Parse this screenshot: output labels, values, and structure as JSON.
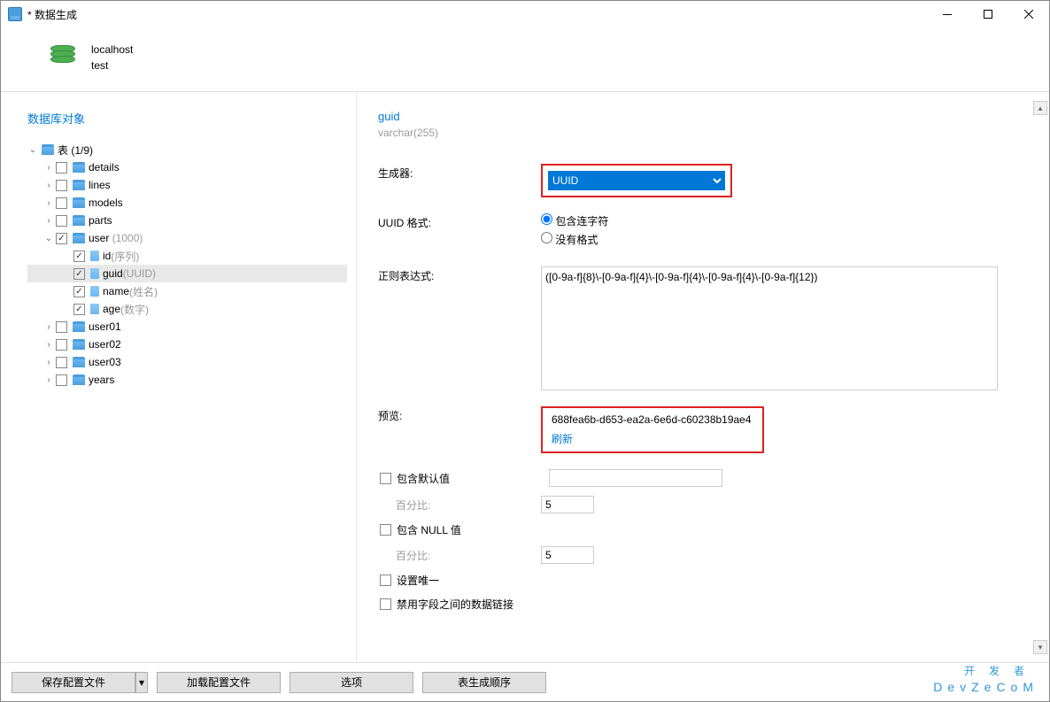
{
  "window": {
    "title": "* 数据生成"
  },
  "connection": {
    "host": "localhost",
    "schema": "test"
  },
  "leftPanel": {
    "title": "数据库对象"
  },
  "tree": {
    "tablesLabel": "表 (1/9)",
    "tables": [
      {
        "name": "details",
        "checked": false
      },
      {
        "name": "lines",
        "checked": false
      },
      {
        "name": "models",
        "checked": false
      },
      {
        "name": "parts",
        "checked": false
      }
    ],
    "userTable": {
      "name": "user",
      "hint": "(1000)",
      "checked": true,
      "columns": [
        {
          "name": "id",
          "hint": "(序列)"
        },
        {
          "name": "guid",
          "hint": "(UUID)",
          "selected": true
        },
        {
          "name": "name",
          "hint": "(姓名)"
        },
        {
          "name": "age",
          "hint": "(数字)"
        }
      ]
    },
    "tablesAfter": [
      {
        "name": "user01"
      },
      {
        "name": "user02"
      },
      {
        "name": "user03"
      },
      {
        "name": "years"
      }
    ]
  },
  "right": {
    "fieldName": "guid",
    "fieldType": "varchar(255)",
    "labels": {
      "generator": "生成器:",
      "uuidFormat": "UUID 格式:",
      "regex": "正则表达式:",
      "preview": "预览:",
      "includeDefault": "包含默认值",
      "percent": "百分比:",
      "includeNull": "包含 NULL 值",
      "unique": "设置唯一",
      "disableLink": "禁用字段之间的数据链接",
      "refresh": "刷新"
    },
    "generatorValue": "UUID",
    "radio": {
      "withHyphen": "包含连字符",
      "noFormat": "没有格式"
    },
    "regexValue": "([0-9a-f]{8}\\-[0-9a-f]{4}\\-[0-9a-f]{4}\\-[0-9a-f]{4}\\-[0-9a-f]{12})",
    "previewValue": "688fea6b-d653-ea2a-6e6d-c60238b19ae4",
    "percentDefault": "5",
    "percentNull": "5"
  },
  "footer": {
    "saveConfig": "保存配置文件",
    "loadConfig": "加载配置文件",
    "options": "选项",
    "tableOrder": "表生成顺序"
  },
  "watermark": {
    "main": "开发者",
    "sub": "DevZeCoM"
  }
}
